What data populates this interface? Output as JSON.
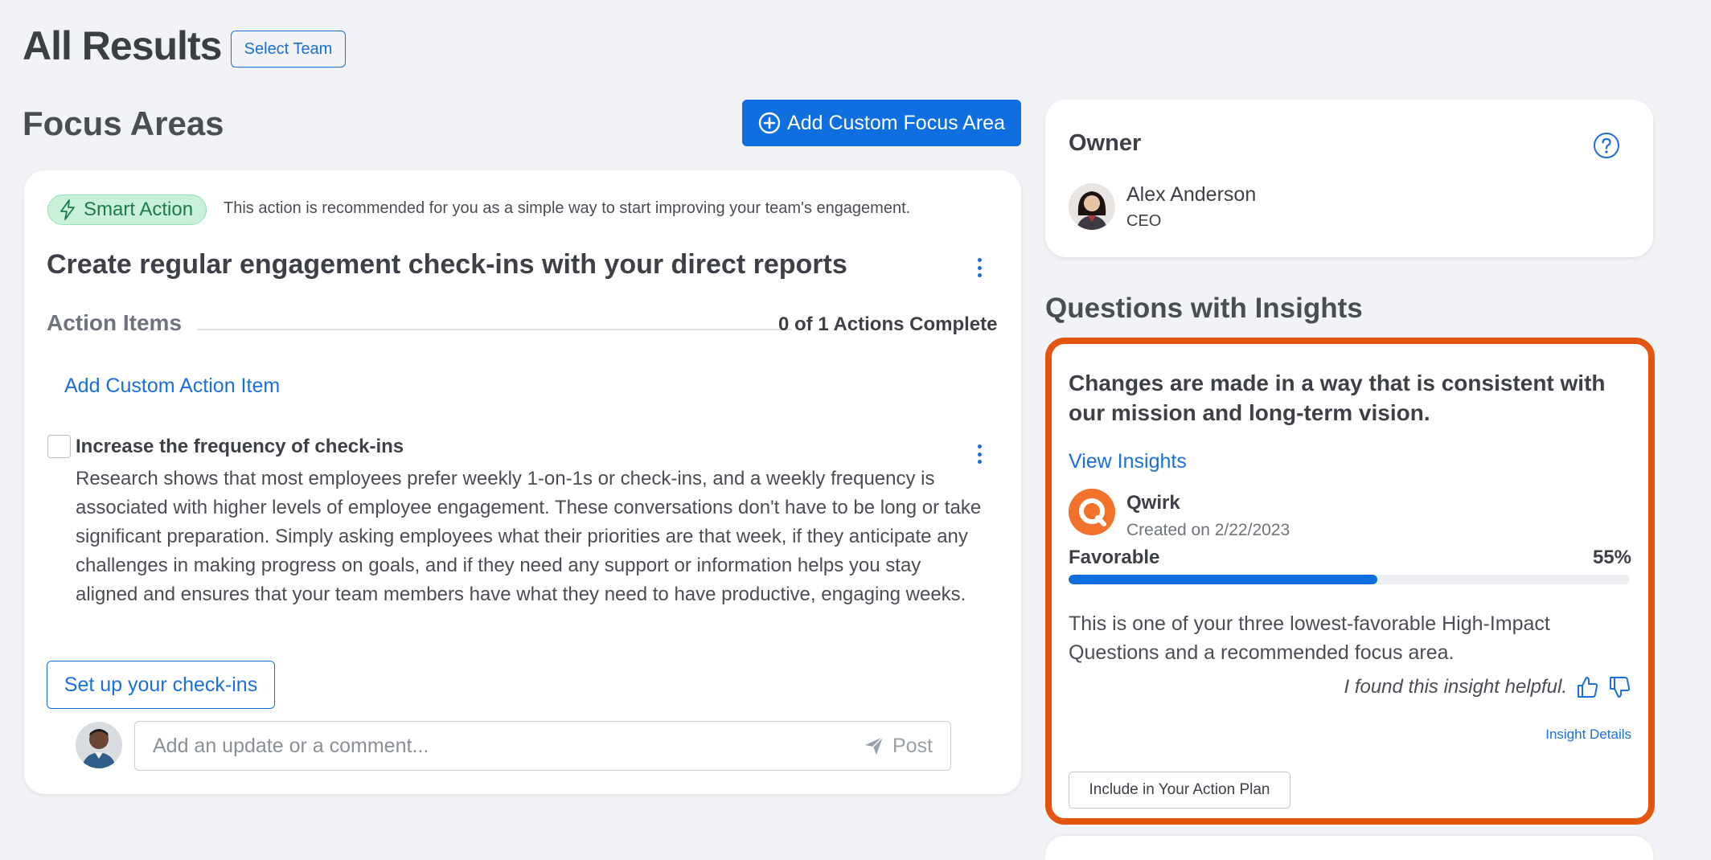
{
  "header": {
    "title": "All Results",
    "select_team_label": "Select Team"
  },
  "focus_areas": {
    "title": "Focus Areas",
    "add_button_label": "Add Custom Focus Area",
    "card": {
      "badge_label": "Smart Action",
      "badge_description": "This action is recommended for you as a simple way to start improving your team's engagement.",
      "title": "Create regular engagement check-ins with your direct reports",
      "action_items_label": "Action Items",
      "actions_complete": "0 of 1 Actions Complete",
      "add_custom_action_label": "Add Custom Action Item",
      "action_item": {
        "title": "Increase the frequency of check-ins",
        "body": "Research shows that most employees prefer weekly 1-on-1s or check-ins, and a weekly frequency is associated with higher levels of employee engagement. These conversations don't have to be long or take significant preparation. Simply asking employees what their priorities are that week, if they anticipate any challenges in making progress on goals, and if they need any support or information helps you stay aligned and ensures that your team members have what they need to have productive, engaging weeks.",
        "checked": false
      },
      "setup_button_label": "Set up your check-ins",
      "comment": {
        "placeholder": "Add an update or a comment...",
        "post_label": "Post"
      }
    }
  },
  "owner": {
    "title": "Owner",
    "name": "Alex Anderson",
    "role": "CEO"
  },
  "insights": {
    "title": "Questions with Insights",
    "card": {
      "question": "Changes are made in a way that is consistent with our mission and long-term vision.",
      "view_insights_label": "View Insights",
      "source_name": "Qwirk",
      "created_on": "Created on 2/22/2023",
      "favorable_label": "Favorable",
      "favorable_pct_text": "55%",
      "favorable_value": 0.55,
      "description": "This is one of your three lowest-favorable High-Impact Questions and a recommended focus area.",
      "helpful_text": "I found this insight helpful.",
      "insight_details_label": "Insight Details",
      "include_button_label": "Include in Your Action Plan"
    }
  },
  "colors": {
    "accent": "#0f6ee0",
    "link": "#1a6fd8",
    "highlight_border": "#e4550f",
    "smart_badge_bg": "#c9f1d9",
    "background": "#f2f3f6"
  },
  "icons": {
    "add_focus": "plus-circle-icon",
    "smart_action": "lightning-bolt-icon",
    "more": "kebab-menu-icon",
    "post": "paper-plane-icon",
    "help": "question-circle-icon",
    "thumbs_up": "thumbs-up-icon",
    "thumbs_down": "thumbs-down-icon",
    "source_logo": "qwirk-logo-icon"
  }
}
